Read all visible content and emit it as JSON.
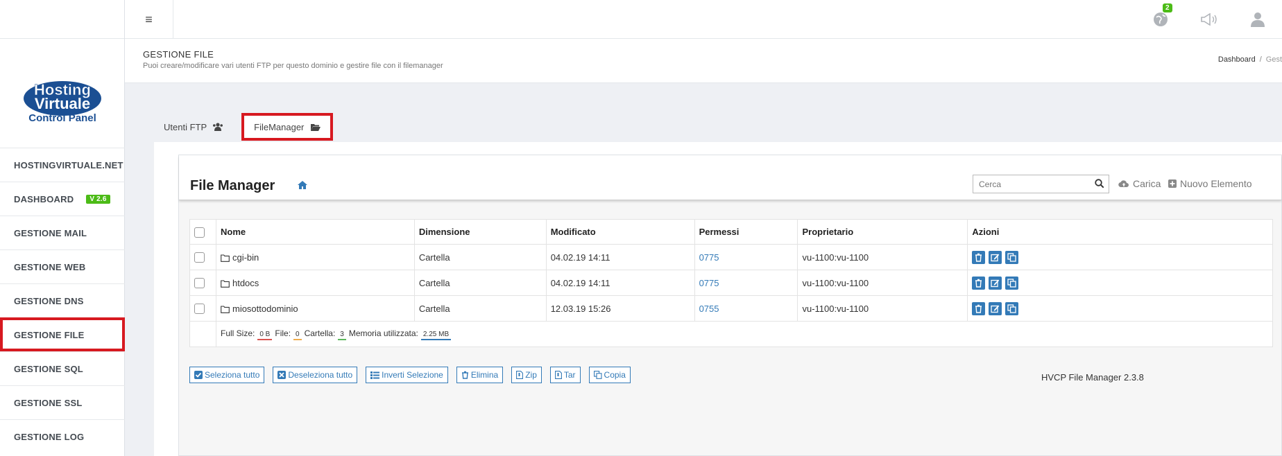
{
  "sidebar": {
    "logo": {
      "line1": "Hosting",
      "line2": "Virtuale",
      "line3": "Control Panel"
    },
    "items": [
      {
        "label": "HOSTINGVIRTUALE.NET"
      },
      {
        "label": "DASHBOARD",
        "badge": "V 2.6"
      },
      {
        "label": "GESTIONE MAIL"
      },
      {
        "label": "GESTIONE WEB"
      },
      {
        "label": "GESTIONE DNS"
      },
      {
        "label": "GESTIONE FILE"
      },
      {
        "label": "GESTIONE SQL"
      },
      {
        "label": "GESTIONE SSL"
      },
      {
        "label": "GESTIONE LOG"
      }
    ]
  },
  "topbar": {
    "notifications_count": "2"
  },
  "header": {
    "title": "GESTIONE FILE",
    "subtitle": "Puoi creare/modificare vari utenti FTP per questo dominio e gestire file con il filemanager",
    "breadcrumb_home": "Dashboard",
    "breadcrumb_sep": "/",
    "breadcrumb_current": "Gest"
  },
  "tabs": [
    {
      "label": "Utenti FTP"
    },
    {
      "label": "FileManager"
    }
  ],
  "filemanager": {
    "title": "File Manager",
    "search_placeholder": "Cerca",
    "upload_label": "Carica",
    "new_label": "Nuovo Elemento",
    "columns": [
      "Nome",
      "Dimensione",
      "Modificato",
      "Permessi",
      "Proprietario",
      "Azioni"
    ],
    "rows": [
      {
        "name": "cgi-bin",
        "size": "Cartella",
        "modified": "04.02.19 14:11",
        "perms": "0775",
        "owner": "vu-1100:vu-1100"
      },
      {
        "name": "htdocs",
        "size": "Cartella",
        "modified": "04.02.19 14:11",
        "perms": "0775",
        "owner": "vu-1100:vu-1100"
      },
      {
        "name": "miosottodominio",
        "size": "Cartella",
        "modified": "12.03.19 15:26",
        "perms": "0755",
        "owner": "vu-1100:vu-1100"
      }
    ],
    "footer": {
      "full_size_label": "Full Size:",
      "full_size": "0 B",
      "files_label": "File:",
      "files": "0",
      "folders_label": "Cartella:",
      "folders": "3",
      "memory_label": "Memoria utilizzata:",
      "memory": "2.25 MB"
    },
    "buttons": {
      "select_all": "Seleziona tutto",
      "deselect_all": "Deseleziona tutto",
      "invert": "Inverti Selezione",
      "delete": "Elimina",
      "zip": "Zip",
      "tar": "Tar",
      "copy": "Copia"
    },
    "version": "HVCP File Manager 2.3.8"
  },
  "colors": {
    "accent": "#337ab7",
    "highlight": "#d71920",
    "badge": "#4cbb17",
    "logo": "#1b4f93"
  }
}
